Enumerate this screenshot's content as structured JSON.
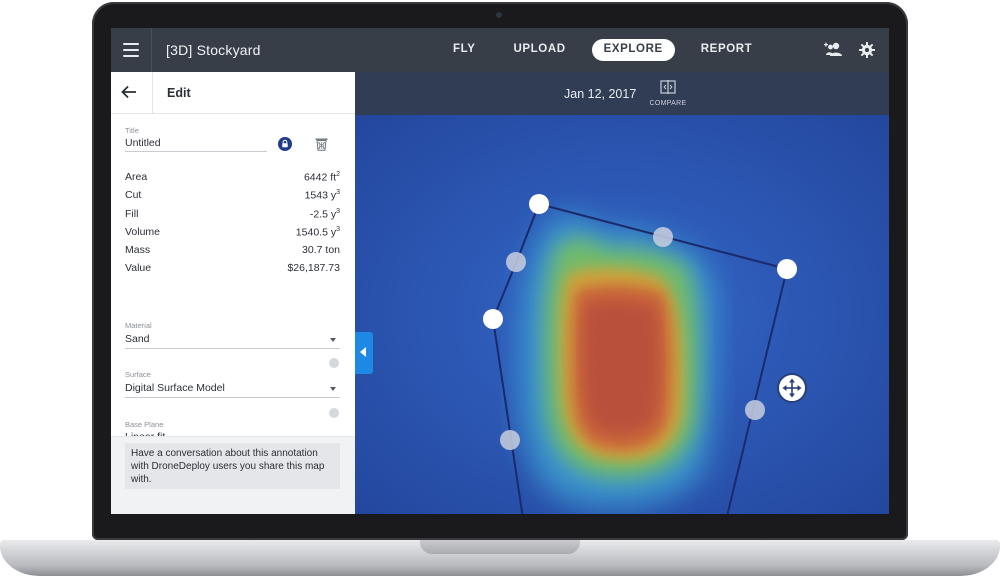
{
  "app": {
    "title": "[3D] Stockyard"
  },
  "nav": {
    "items": [
      {
        "label": "FLY",
        "active": false
      },
      {
        "label": "UPLOAD",
        "active": false
      },
      {
        "label": "EXPLORE",
        "active": true
      },
      {
        "label": "REPORT",
        "active": false
      }
    ]
  },
  "icons": {
    "menu": "hamburger-icon",
    "users": "add-users-icon",
    "settings": "gear-icon",
    "back": "arrow-left-icon",
    "lock": "lock-icon",
    "trash": "trash-icon",
    "compare": "compare-icon",
    "collapse": "chevron-left-icon",
    "move": "move-arrows-icon"
  },
  "panel": {
    "header": "Edit",
    "title_label": "Title",
    "title_value": "Untitled",
    "metrics": [
      {
        "label": "Area",
        "value": "6442 ft",
        "sup": "2"
      },
      {
        "label": "Cut",
        "value": "1543 y",
        "sup": "3"
      },
      {
        "label": "Fill",
        "value": "-2.5 y",
        "sup": "3"
      },
      {
        "label": "Volume",
        "value": "1540.5 y",
        "sup": "3"
      },
      {
        "label": "Mass",
        "value": "30.7 ton",
        "sup": ""
      },
      {
        "label": "Value",
        "value": "$26,187.73",
        "sup": ""
      }
    ],
    "material_label": "Material",
    "material_value": "Sand",
    "surface_label": "Surface",
    "surface_value": "Digital Surface Model",
    "baseplane_label": "Base Plane",
    "baseplane_value": "Linear fit",
    "conversation": "Have a conversation about this annotation with DroneDeploy users you share this map with."
  },
  "map": {
    "date": "Jan 12, 2017",
    "compare_label": "COMPARE"
  },
  "colors": {
    "topbar": "#383e48",
    "map_water": "#2e58b8",
    "accent_blue": "#1e88e5",
    "polygon_line": "#1b2a6b"
  }
}
